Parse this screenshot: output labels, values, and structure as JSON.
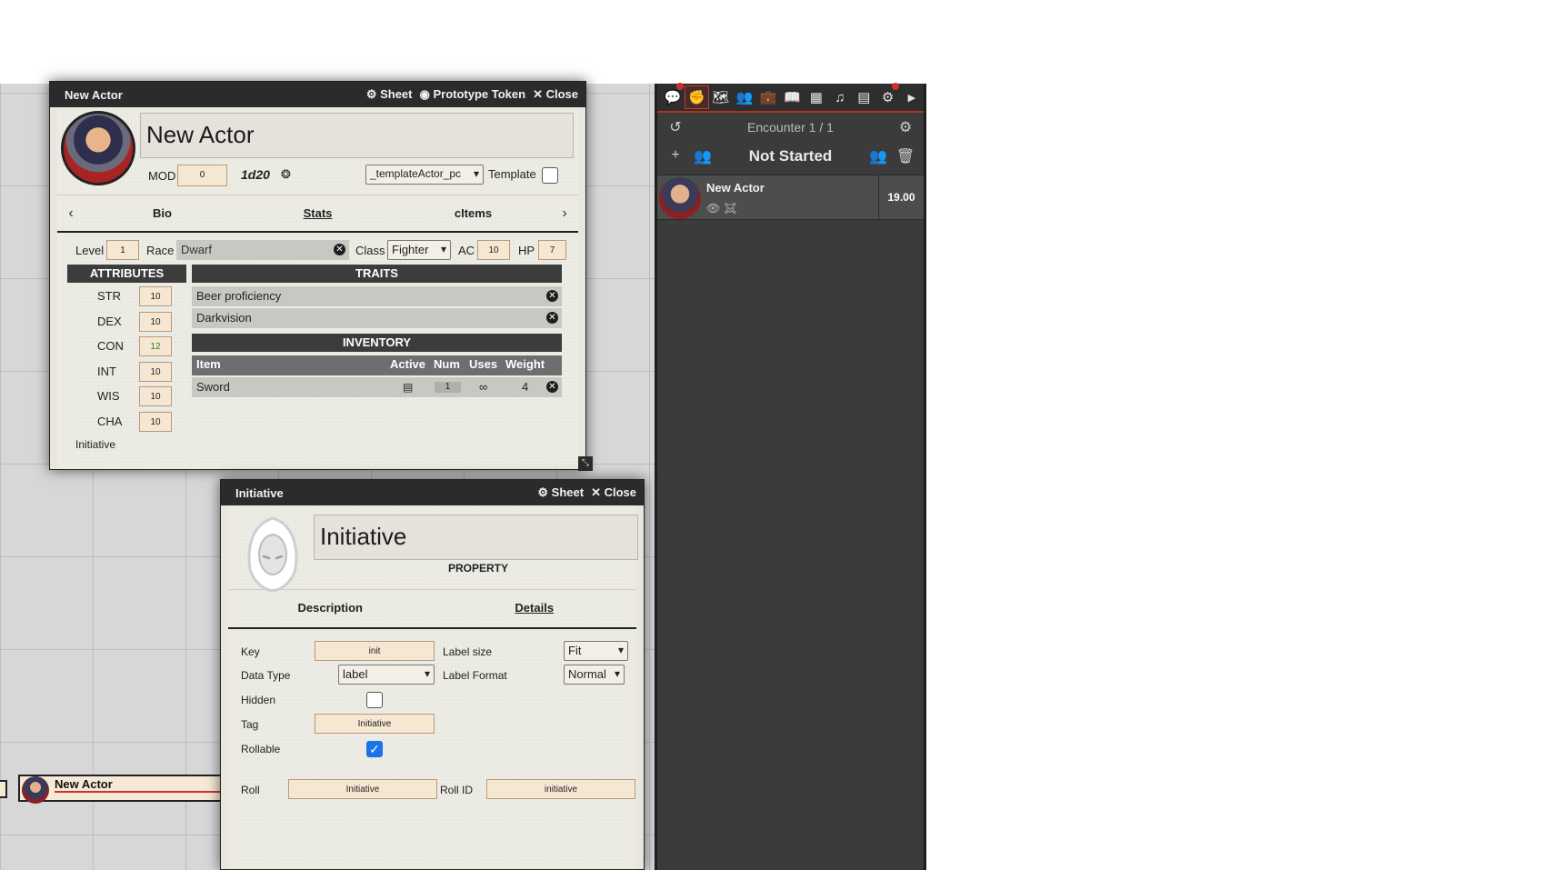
{
  "actor_sheet": {
    "header": {
      "title": "New Actor",
      "sheet": "Sheet",
      "prototype_token": "Prototype Token",
      "close": "Close"
    },
    "name": "New Actor",
    "mod_label": "MOD",
    "mod_value": "0",
    "dice": "1d20",
    "template_select": "_templateActor_pc",
    "template_label": "Template",
    "tabs": [
      "Bio",
      "Stats",
      "cItems"
    ],
    "level_label": "Level",
    "level": "1",
    "race_label": "Race",
    "race": "Dwarf",
    "class_label": "Class",
    "class": "Fighter",
    "ac_label": "AC",
    "ac": "10",
    "hp_label": "HP",
    "hp": "7",
    "attributes_title": "ATTRIBUTES",
    "attributes": [
      {
        "name": "STR",
        "value": "10"
      },
      {
        "name": "DEX",
        "value": "10"
      },
      {
        "name": "CON",
        "value": "12"
      },
      {
        "name": "INT",
        "value": "10"
      },
      {
        "name": "WIS",
        "value": "10"
      },
      {
        "name": "CHA",
        "value": "10"
      }
    ],
    "initiative_label": "Initiative",
    "traits_title": "TRAITS",
    "traits": [
      "Beer proficiency",
      "Darkvision"
    ],
    "inventory_title": "INVENTORY",
    "inventory_headers": {
      "item": "Item",
      "active": "Active",
      "num": "Num",
      "uses": "Uses",
      "weight": "Weight"
    },
    "inventory": [
      {
        "item": "Sword",
        "num": "1",
        "uses": "∞",
        "weight": "4"
      }
    ]
  },
  "sidebar": {
    "tabs": [
      "chat",
      "combat",
      "scenes",
      "actors",
      "items",
      "journal",
      "tables",
      "playlists",
      "compendium",
      "settings"
    ],
    "encounter": "Encounter 1 / 1",
    "state": "Not Started",
    "combatant": {
      "name": "New Actor",
      "initiative": "19.00"
    }
  },
  "property_sheet": {
    "header": {
      "title": "Initiative",
      "sheet": "Sheet",
      "close": "Close"
    },
    "name": "Initiative",
    "type_label": "PROPERTY",
    "tabs": [
      "Description",
      "Details"
    ],
    "key_label": "Key",
    "key": "init",
    "label_size_label": "Label size",
    "label_size": "Fit",
    "data_type_label": "Data Type",
    "data_type": "label",
    "label_format_label": "Label Format",
    "label_format": "Normal",
    "hidden_label": "Hidden",
    "tag_label": "Tag",
    "tag": "Initiative",
    "rollable_label": "Rollable",
    "roll_label": "Roll",
    "roll": "Initiative",
    "roll_id_label": "Roll ID",
    "roll_id": "initiative"
  },
  "token": {
    "name": "New Actor"
  }
}
